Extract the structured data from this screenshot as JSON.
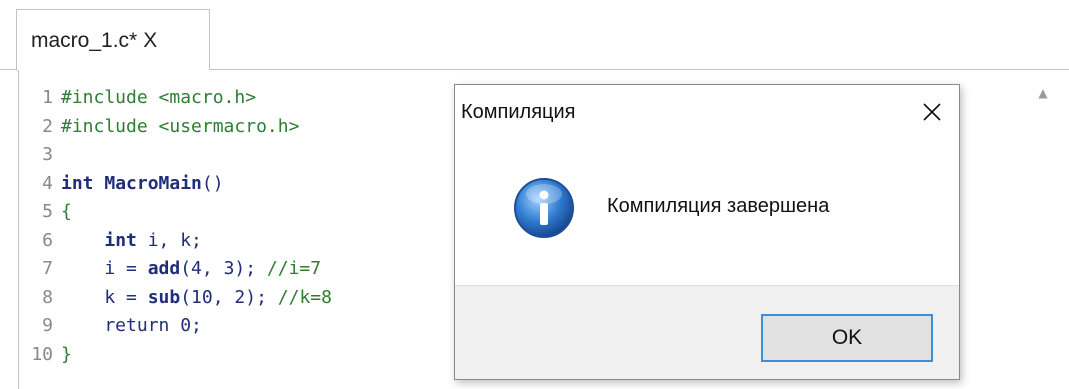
{
  "tab": {
    "label": "macro_1.c*",
    "close_label": "X"
  },
  "editor": {
    "lines": [
      {
        "num": "1",
        "tokens": [
          {
            "t": "pre",
            "v": "#include <macro.h>"
          }
        ]
      },
      {
        "num": "2",
        "tokens": [
          {
            "t": "pre",
            "v": "#include <usermacro.h>"
          }
        ]
      },
      {
        "num": "3",
        "tokens": []
      },
      {
        "num": "4",
        "tokens": [
          {
            "t": "kw",
            "v": "int"
          },
          {
            "t": "txt",
            "v": " "
          },
          {
            "t": "fn",
            "v": "MacroMain"
          },
          {
            "t": "txt",
            "v": "()"
          }
        ]
      },
      {
        "num": "5",
        "tokens": [
          {
            "t": "pre",
            "v": "{"
          }
        ]
      },
      {
        "num": "6",
        "tokens": [
          {
            "t": "txt",
            "v": "    "
          },
          {
            "t": "kw",
            "v": "int"
          },
          {
            "t": "txt",
            "v": " i, k;"
          }
        ]
      },
      {
        "num": "7",
        "tokens": [
          {
            "t": "txt",
            "v": "    i = "
          },
          {
            "t": "fn",
            "v": "add"
          },
          {
            "t": "txt",
            "v": "(4, 3); "
          },
          {
            "t": "cmt",
            "v": "//i=7"
          }
        ]
      },
      {
        "num": "8",
        "tokens": [
          {
            "t": "txt",
            "v": "    k = "
          },
          {
            "t": "fn",
            "v": "sub"
          },
          {
            "t": "txt",
            "v": "(10, 2); "
          },
          {
            "t": "cmt",
            "v": "//k=8"
          }
        ]
      },
      {
        "num": "9",
        "tokens": [
          {
            "t": "txt",
            "v": "    return 0;"
          }
        ]
      },
      {
        "num": "10",
        "tokens": [
          {
            "t": "pre",
            "v": "}"
          }
        ]
      }
    ]
  },
  "dialog": {
    "title": "Компиляция",
    "message": "Компиляция завершена",
    "ok_label": "OK",
    "icon": "info-icon"
  },
  "colors": {
    "accent": "#3c8fd6",
    "preprocessor": "#2e7d32",
    "keyword": "#1f2d7a",
    "comment": "#2e7d32"
  }
}
